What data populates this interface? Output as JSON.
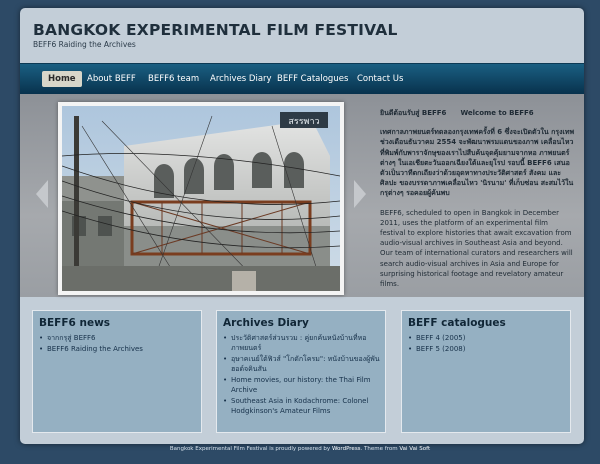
{
  "site": {
    "title": "BANGKOK EXPERIMENTAL FILM FESTIVAL",
    "description": "BEFF6 Raiding the Archives"
  },
  "nav": {
    "items": [
      {
        "label": "Home",
        "active": true
      },
      {
        "label": "About BEFF"
      },
      {
        "label": "BEFF6 team"
      },
      {
        "label": "Archives Diary"
      },
      {
        "label": "BEFF Catalogues"
      },
      {
        "label": "Contact Us"
      }
    ]
  },
  "hero": {
    "heading_thai": "ยินดีต้อนรับสู่ BEFF6",
    "heading_en": "Welcome to BEFF6",
    "thai_text": "เทศกาลภาพยนตร์ทดลองกรุงเทพครั้งที่ 6 ซึ่งจะเปิดตัวใน กรุงเทพช่วงเดือนธันวาคม 2554 จะพัฒนาพรมแดนของภาพ เคลื่อนไหวที่พิมพ์กับพาราจักษุของเราไปสืบค้นจุดคุ้มยามจากหอ ภาพยนตร์ต่างๆ ในเอเชียตะวันออกเฉียงใต้และยุโรป รอบนี้ BEFF6 เสนอตัวเป็นวาทีตกเถียงว่าด้วยอุดหาทางประวัติศาสตร์ สังคม และศิลปะ ของบรรดาภาพเคลื่อนไหว 'นิรนาม' ที่เก็บซ่อน สะสมไว้ในกรุต่างๆ รอคอยผู้ค้นพบ",
    "english_text": "BEFF6, scheduled to open in Bangkok in December 2011, uses the platform of an experimental film festival to explore histories that await excavation from audio-visual archives in Southeast Asia and beyond. Our team of international curators and researchers will search audio-visual archives in Asia and Europe for surprising historical footage and revelatory amateur films.",
    "photo_sign_text": "สรรพาว",
    "prev_icon": "chevron-left-icon",
    "next_icon": "chevron-right-icon"
  },
  "widgets": [
    {
      "title": "BEFF6 news",
      "items": [
        "จากกรุสู่ BEFF6",
        "BEFF6 Raiding the Archives"
      ]
    },
    {
      "title": "Archives Diary",
      "items": [
        "ประวัติศาสตร์ส่วนรวม : คู่ยกค้นหนังบ้านที่หอภาพยนตร์",
        "อุษาคเนย์ใต้ฟิวส์ \"โกดักโครม\": หนังบ้านของผู้พันฮอด์จคินสัน",
        "Home movies, our history: the Thai Film Archive",
        "Southeast Asia in Kodachrome: Colonel Hodgkinson's Amateur Films"
      ]
    },
    {
      "title": "BEFF catalogues",
      "items": [
        "BEFF 4 (2005)",
        "BEFF 5 (2008)"
      ]
    }
  ],
  "footer": {
    "prefix": "Bangkok Experimental Film Festival is proudly powered by",
    "wordpress": "WordPress",
    "theme_text": ". Theme from",
    "theme_link": "Vai Vai Soft"
  },
  "colors": {
    "background": "#2d4a66",
    "panel": "#c3ced8",
    "nav": "#0e4563",
    "widget": "#95b0c2"
  }
}
